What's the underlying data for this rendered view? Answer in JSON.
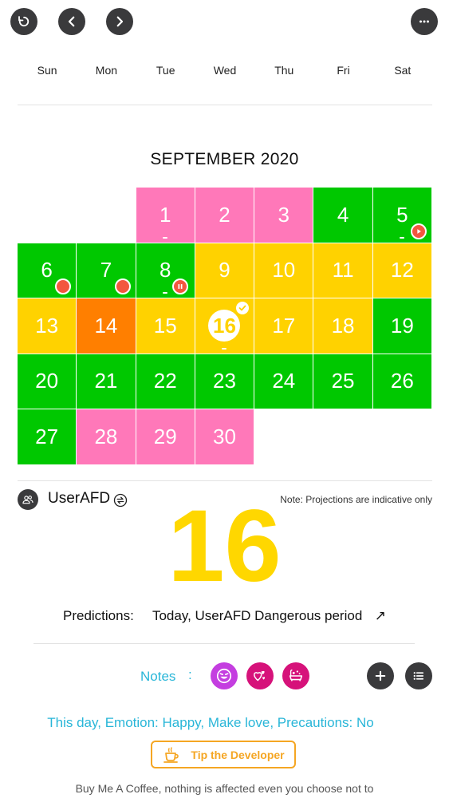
{
  "toolbar": {
    "refresh_icon": "refresh-icon",
    "prev_icon": "chevron-left-icon",
    "next_icon": "chevron-right-icon",
    "more_icon": "more-dots-icon"
  },
  "weekdays": [
    "Sun",
    "Mon",
    "Tue",
    "Wed",
    "Thu",
    "Fri",
    "Sat"
  ],
  "calendar": {
    "title": "SEPTEMBER 2020",
    "colors": {
      "pink": "#ff78b9",
      "green": "#00c800",
      "yellow": "#ffd200",
      "orange": "#ff7f00"
    },
    "leading_blanks": 2,
    "days": [
      {
        "day": "1",
        "color": "pink",
        "dash": true
      },
      {
        "day": "2",
        "color": "pink"
      },
      {
        "day": "3",
        "color": "pink"
      },
      {
        "day": "4",
        "color": "green"
      },
      {
        "day": "5",
        "color": "green",
        "dash": true,
        "marker": "play"
      },
      {
        "day": "6",
        "color": "green",
        "marker": "dot"
      },
      {
        "day": "7",
        "color": "green",
        "marker": "dot"
      },
      {
        "day": "8",
        "color": "green",
        "dash": true,
        "marker": "pause"
      },
      {
        "day": "9",
        "color": "yellow"
      },
      {
        "day": "10",
        "color": "yellow"
      },
      {
        "day": "11",
        "color": "yellow"
      },
      {
        "day": "12",
        "color": "yellow"
      },
      {
        "day": "13",
        "color": "yellow"
      },
      {
        "day": "14",
        "color": "orange"
      },
      {
        "day": "15",
        "color": "yellow"
      },
      {
        "day": "16",
        "color": "yellow",
        "today": true,
        "checked": true,
        "dash": true
      },
      {
        "day": "17",
        "color": "yellow"
      },
      {
        "day": "18",
        "color": "yellow"
      },
      {
        "day": "19",
        "color": "green"
      },
      {
        "day": "20",
        "color": "green"
      },
      {
        "day": "21",
        "color": "green"
      },
      {
        "day": "22",
        "color": "green"
      },
      {
        "day": "23",
        "color": "green"
      },
      {
        "day": "24",
        "color": "green"
      },
      {
        "day": "25",
        "color": "green"
      },
      {
        "day": "26",
        "color": "green"
      },
      {
        "day": "27",
        "color": "green"
      },
      {
        "day": "28",
        "color": "pink"
      },
      {
        "day": "29",
        "color": "pink"
      },
      {
        "day": "30",
        "color": "pink"
      }
    ]
  },
  "user": {
    "name": "UserAFD",
    "note": "Note: Projections are indicative only"
  },
  "big_day": "16",
  "predictions": {
    "label": "Predictions:",
    "value": "Today, UserAFD Dangerous period",
    "arrow": "↗"
  },
  "notes": {
    "label": "Notes",
    "colon": ":",
    "icons": [
      {
        "name": "happy-face-icon",
        "color": "#c43ee0"
      },
      {
        "name": "hearts-icon",
        "color": "#d6127a"
      },
      {
        "name": "bathtub-icon",
        "color": "#d6127a"
      }
    ],
    "add_icon": "plus-icon",
    "list_icon": "list-icon"
  },
  "day_description": "This day, Emotion: Happy, Make love, Precautions: No",
  "tip_button": {
    "label": "Tip the Developer",
    "icon": "coffee-cup-icon",
    "color": "#f5a623"
  },
  "footer": "Buy Me A Coffee, nothing is affected even you choose not to"
}
